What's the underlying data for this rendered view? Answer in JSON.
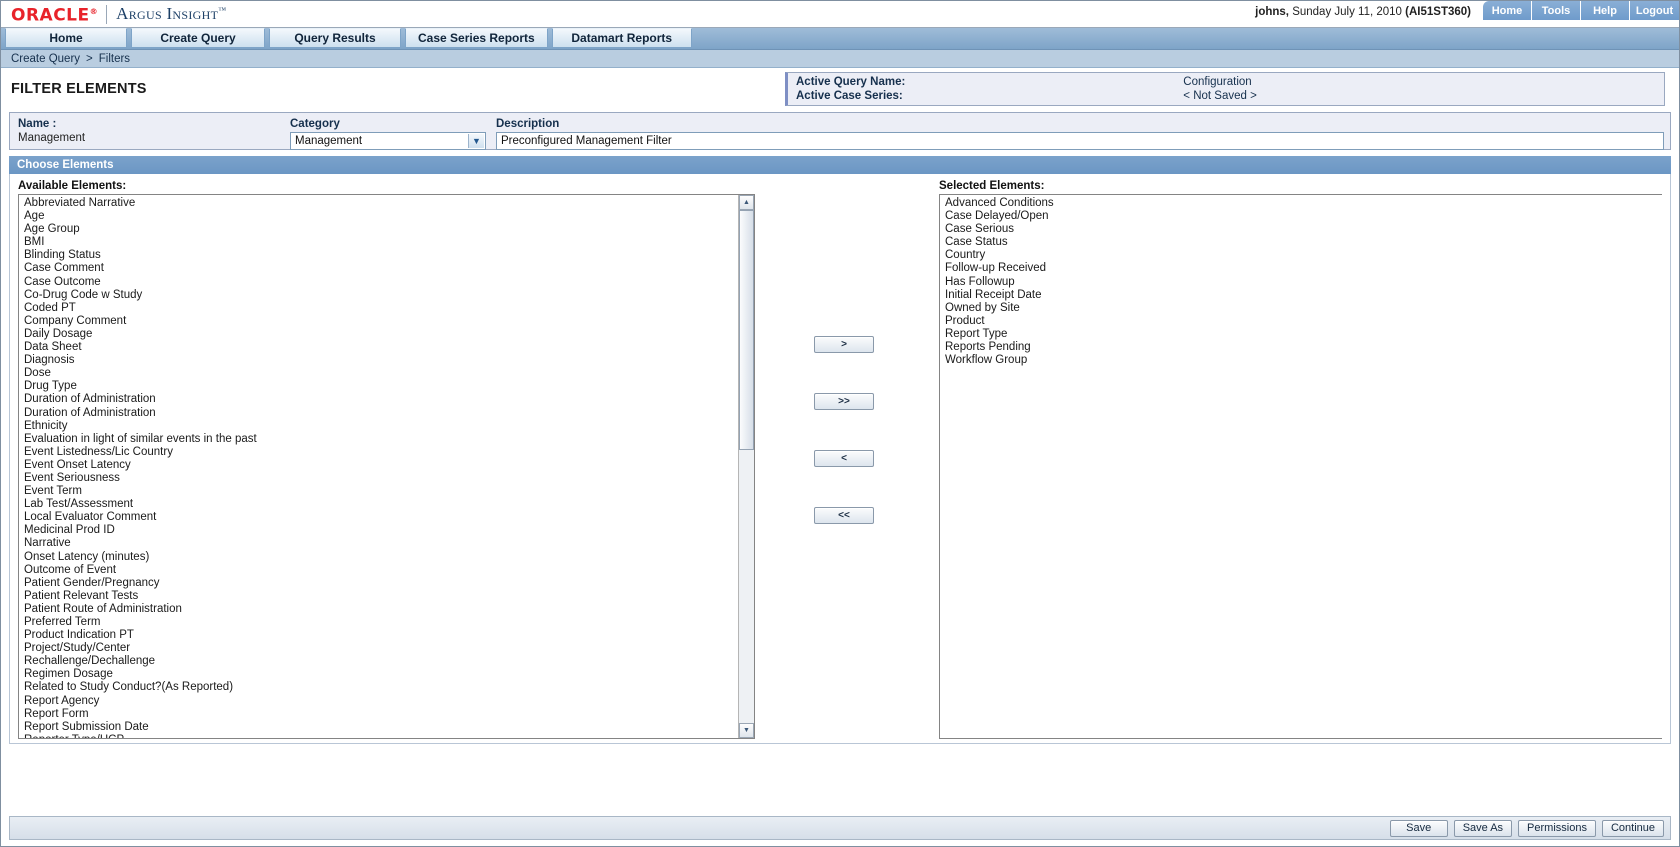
{
  "brand": {
    "oracle": "ORACLE",
    "oracle_reg": "®",
    "product": "Argus Insight",
    "tm": "™"
  },
  "header": {
    "user": "johns,",
    "session": " Sunday July 11, 2010 ",
    "session_code": "(AI51ST360)",
    "nav": [
      {
        "label": "Home",
        "name": "top-nav-home"
      },
      {
        "label": "Tools",
        "name": "top-nav-tools"
      },
      {
        "label": "Help",
        "name": "top-nav-help"
      },
      {
        "label": "Logout",
        "name": "top-nav-logout"
      }
    ]
  },
  "tabs": [
    {
      "label": "Home",
      "active": false
    },
    {
      "label": "Create Query",
      "active": false
    },
    {
      "label": "Query Results",
      "active": false
    },
    {
      "label": "Case Series Reports",
      "active": false
    },
    {
      "label": "Datamart Reports",
      "active": false
    }
  ],
  "breadcrumb": {
    "parent": "Create Query",
    "separator": ">",
    "current": "Filters"
  },
  "page": {
    "title": "FILTER ELEMENTS"
  },
  "active_panel": {
    "query_name_label": "Active Query Name:",
    "case_series_label": "Active Case Series:",
    "query_name_value": "Configuration",
    "case_series_value": "< Not Saved >"
  },
  "meta": {
    "name_label": "Name :",
    "name_value": "Management",
    "category_label": "Category",
    "category_value": "Management",
    "category_options": [
      "Management"
    ],
    "description_label": "Description",
    "description_value": "Preconfigured Management Filter",
    "description_placeholder": ""
  },
  "section": {
    "title": "Choose Elements",
    "available_label": "Available Elements:",
    "selected_label": "Selected Elements:"
  },
  "available_elements": [
    "Abbreviated Narrative",
    "Age",
    "Age Group",
    "BMI",
    "Blinding Status",
    "Case Comment",
    "Case Outcome",
    "Co-Drug Code w Study",
    "Coded PT",
    "Company Comment",
    "Daily Dosage",
    "Data Sheet",
    "Diagnosis",
    "Dose",
    "Drug Type",
    "Duration of Administration",
    "Duration of Administration",
    "Ethnicity",
    "Evaluation in light of similar events in the past",
    "Event Listedness/Lic Country",
    "Event Onset Latency",
    "Event Seriousness",
    "Event Term",
    "Lab Test/Assessment",
    "Local Evaluator Comment",
    "Medicinal Prod ID",
    "Narrative",
    "Onset Latency (minutes)",
    "Outcome of Event",
    "Patient Gender/Pregnancy",
    "Patient Relevant Tests",
    "Patient Route of Administration",
    "Preferred Term",
    "Product Indication PT",
    "Project/Study/Center",
    "Rechallenge/Dechallenge",
    "Regimen Dosage",
    "Related to Study Conduct?(As Reported)",
    "Report Agency",
    "Report Form",
    "Report Submission Date",
    "Reporter Type/HCP"
  ],
  "selected_elements": [
    "Advanced Conditions",
    "Case Delayed/Open",
    "Case Serious",
    "Case Status",
    "Country",
    "Follow-up Received",
    "Has Followup",
    "Initial Receipt Date",
    "Owned by Site",
    "Product",
    "Report Type",
    "Reports Pending",
    "Workflow Group"
  ],
  "transfer_buttons": [
    {
      "label": ">",
      "name": "move-right-button"
    },
    {
      "label": ">>",
      "name": "move-all-right-button"
    },
    {
      "label": "<",
      "name": "move-left-button"
    },
    {
      "label": "<<",
      "name": "move-all-left-button"
    }
  ],
  "footer_buttons": [
    {
      "label": "Save",
      "name": "save-button"
    },
    {
      "label": "Save As",
      "name": "save-as-button"
    },
    {
      "label": "Permissions",
      "name": "permissions-button"
    },
    {
      "label": "Continue",
      "name": "continue-button"
    }
  ],
  "icons": {
    "scroll_up": "▲",
    "scroll_down": "▼",
    "select_chevron": "▼"
  },
  "colors": {
    "oracle_red": "#e8232a",
    "argus_blue": "#1c3f66",
    "accent_blue": "#7ba2cb",
    "panel_bg": "#eceef6"
  }
}
